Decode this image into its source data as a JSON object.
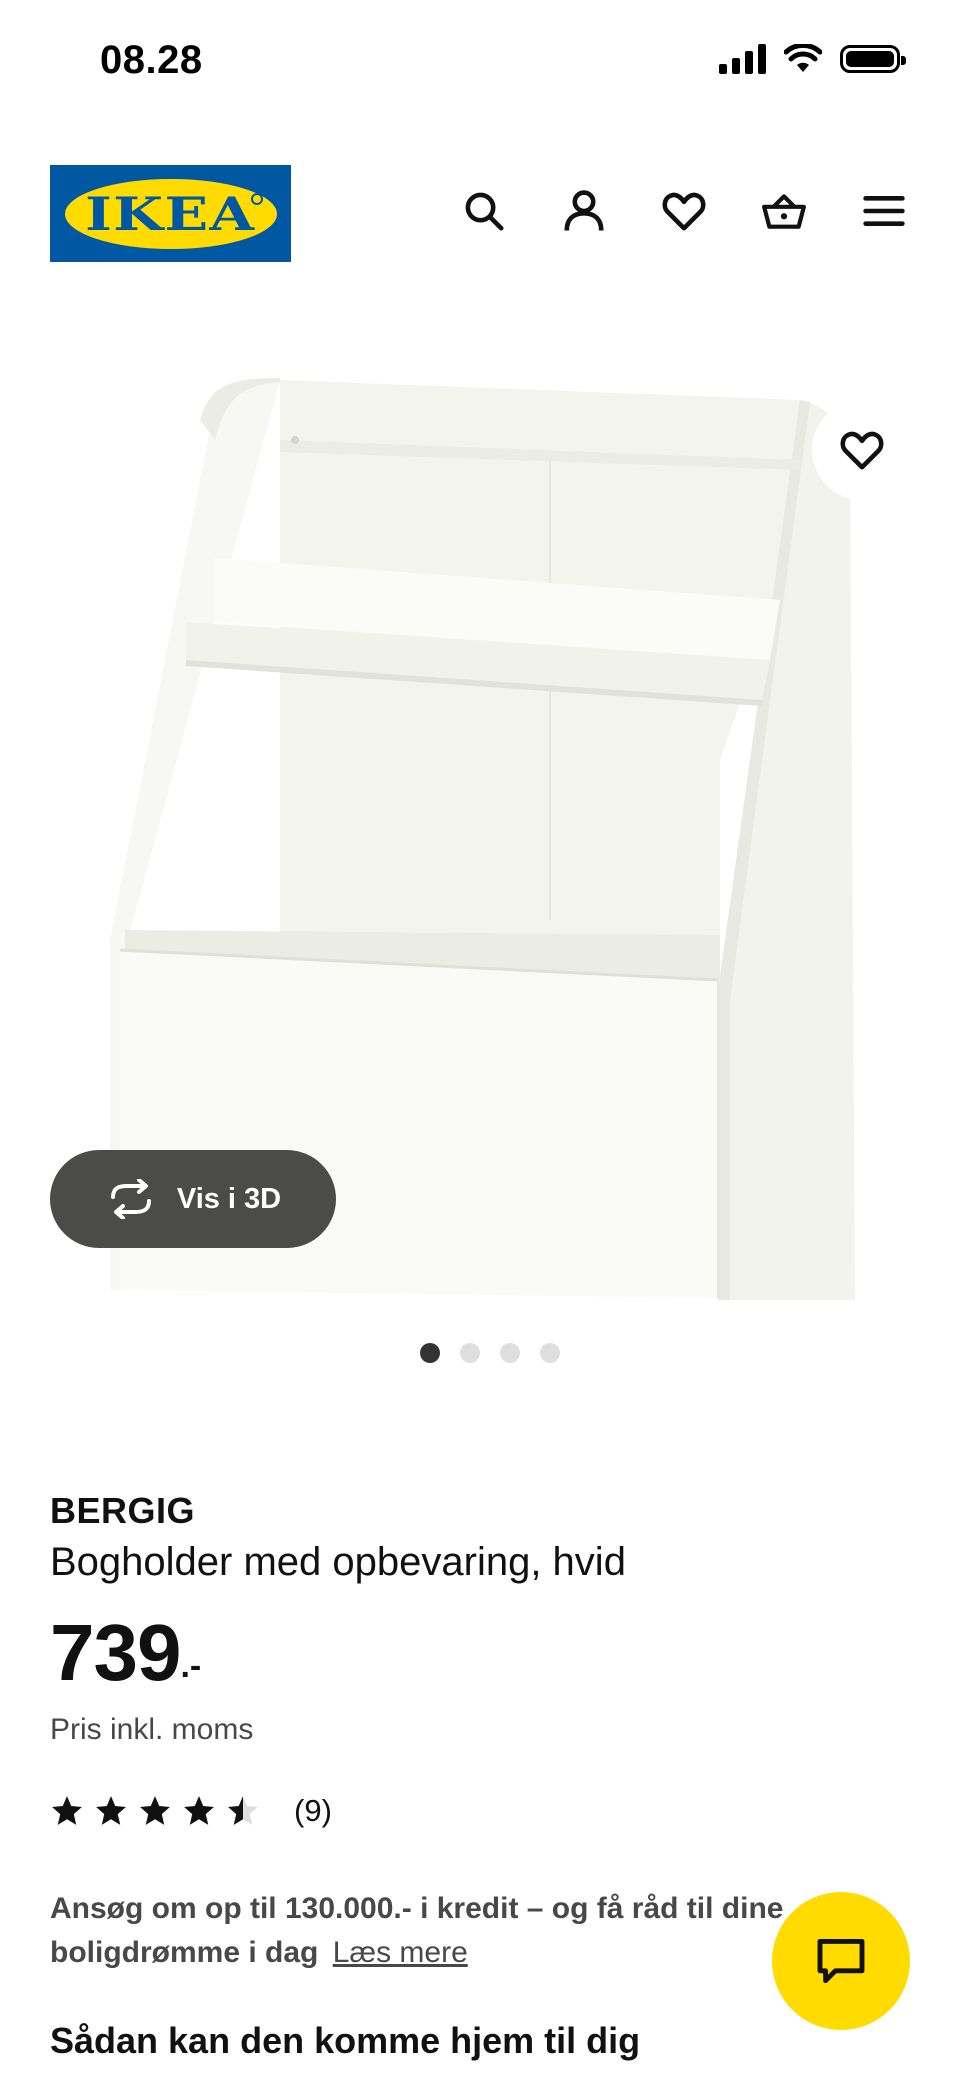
{
  "status_bar": {
    "time": "08.28",
    "icons": [
      "signal-icon",
      "wifi-icon",
      "battery-icon"
    ]
  },
  "header": {
    "logo_text": "IKEA",
    "nav": [
      "search-icon",
      "account-icon",
      "favorites-icon",
      "basket-icon",
      "menu-icon"
    ]
  },
  "gallery": {
    "favorite_icon": "heart-icon",
    "view_3d_label": "Vis i 3D",
    "view_3d_icon": "rotate-icon",
    "image_count": 4,
    "active_index": 0
  },
  "product": {
    "brand": "BERGIG",
    "description": "Bogholder med opbevaring, hvid",
    "price": "739",
    "price_suffix": ".-",
    "vat_note": "Pris inkl. moms",
    "rating": 4.5,
    "rating_count": "(9)"
  },
  "credit": {
    "text": "Ansøg om op til 130.000.- i kredit – og få råd til dine boligdrømme i dag",
    "link": "Læs mere"
  },
  "delivery_heading": "Sådan kan den komme hjem til dig",
  "chat_icon": "chat-icon",
  "colors": {
    "ikea_blue": "#0058a3",
    "ikea_yellow": "#ffdb00",
    "dark_pill": "#4b4b49"
  }
}
